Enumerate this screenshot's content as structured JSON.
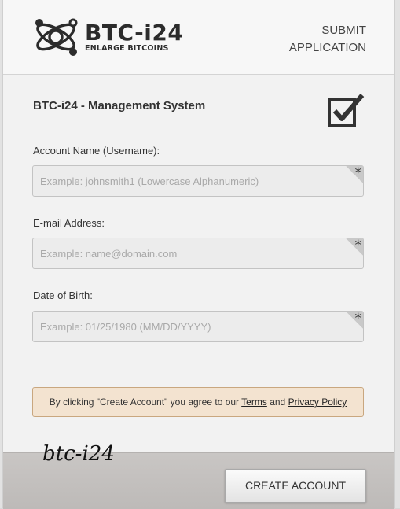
{
  "header": {
    "brand": "BTC-i24",
    "tagline": "ENLARGE BITCOINS",
    "submit_line1": "SUBMIT",
    "submit_line2": "APPLICATION"
  },
  "form": {
    "title": "BTC-i24 - Management System",
    "fields": [
      {
        "label": "Account Name (Username):",
        "value": "",
        "placeholder": "Example: johnsmith1 (Lowercase Alphanumeric)",
        "required_mark": "*"
      },
      {
        "label": "E-mail Address:",
        "value": "",
        "placeholder": "Example: name@domain.com",
        "required_mark": "*"
      },
      {
        "label": "Date of Birth:",
        "value": "",
        "placeholder": "Example: 01/25/1980 (MM/DD/YYYY)",
        "required_mark": "*"
      }
    ]
  },
  "notice": {
    "prefix": "By clicking \"Create Account\" you agree to our",
    "terms": "Terms",
    "and": "and",
    "privacy": "Privacy Policy"
  },
  "footer": {
    "signature": "btc-i24",
    "create_label": "CREATE ACCOUNT"
  },
  "icons": {
    "logo": "atom-logo-icon",
    "checkbox": "checked-box-icon"
  },
  "colors": {
    "notice_bg": "#f3e3d0",
    "notice_border": "#c9a77f",
    "footer_bg": "#c9c6c4"
  }
}
